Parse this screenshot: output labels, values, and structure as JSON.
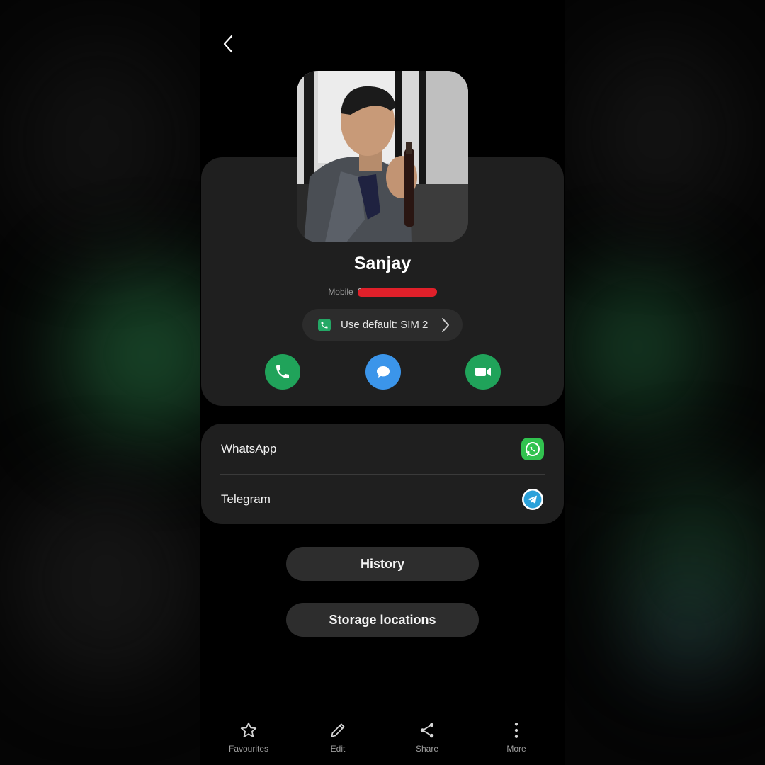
{
  "header": {
    "back_icon": "chevron-left-icon"
  },
  "contact": {
    "name": "Sanjay",
    "phone_type": "Mobile",
    "phone_number_visible": "07",
    "phone_number_redacted": true
  },
  "sim_selector": {
    "label": "Use default: SIM 2",
    "icon": "phone-icon"
  },
  "actions": [
    {
      "name": "call",
      "icon": "phone-icon",
      "color": "#20a35a"
    },
    {
      "name": "message",
      "icon": "chat-bubble-icon",
      "color": "#3b95ea"
    },
    {
      "name": "video-call",
      "icon": "video-camera-icon",
      "color": "#20a35a"
    }
  ],
  "linked_apps": [
    {
      "label": "WhatsApp",
      "icon": "whatsapp-icon",
      "color": "#31c24f"
    },
    {
      "label": "Telegram",
      "icon": "telegram-icon",
      "color": "#2aa1da"
    }
  ],
  "buttons": {
    "history": "History",
    "storage": "Storage locations"
  },
  "bottom_nav": [
    {
      "label": "Favourites",
      "icon": "star-icon"
    },
    {
      "label": "Edit",
      "icon": "pencil-icon"
    },
    {
      "label": "Share",
      "icon": "share-icon"
    },
    {
      "label": "More",
      "icon": "more-vertical-icon"
    }
  ]
}
